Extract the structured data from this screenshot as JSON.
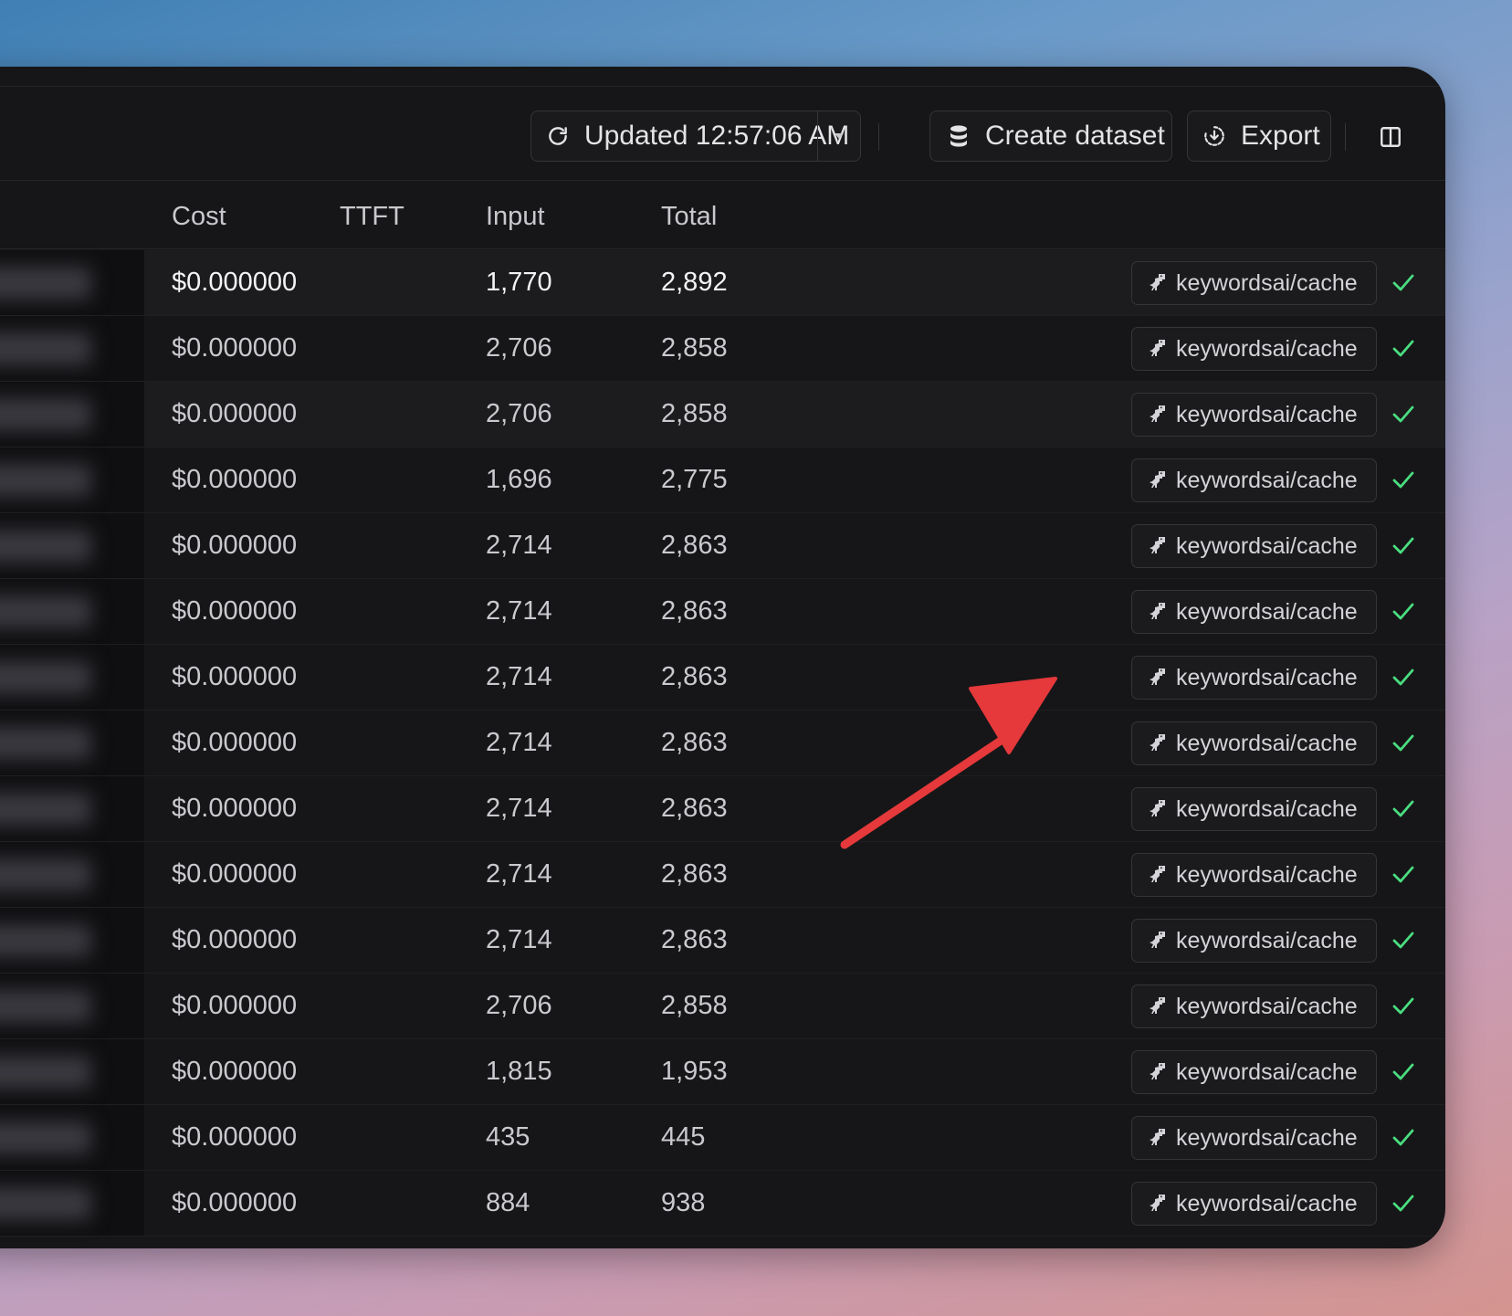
{
  "toolbar": {
    "updated_label": "Updated 12:57:06 AM",
    "create_dataset_label": "Create dataset",
    "export_label": "Export"
  },
  "table": {
    "columns": [
      "Cost",
      "TTFT",
      "Input",
      "Total"
    ],
    "rows": [
      {
        "cost": "$0.000000",
        "ttft": "",
        "input": "1,770",
        "total": "2,892",
        "tag": "keywordsai/cache"
      },
      {
        "cost": "$0.000000",
        "ttft": "",
        "input": "2,706",
        "total": "2,858",
        "tag": "keywordsai/cache"
      },
      {
        "cost": "$0.000000",
        "ttft": "",
        "input": "2,706",
        "total": "2,858",
        "tag": "keywordsai/cache"
      },
      {
        "cost": "$0.000000",
        "ttft": "",
        "input": "1,696",
        "total": "2,775",
        "tag": "keywordsai/cache"
      },
      {
        "cost": "$0.000000",
        "ttft": "",
        "input": "2,714",
        "total": "2,863",
        "tag": "keywordsai/cache"
      },
      {
        "cost": "$0.000000",
        "ttft": "",
        "input": "2,714",
        "total": "2,863",
        "tag": "keywordsai/cache"
      },
      {
        "cost": "$0.000000",
        "ttft": "",
        "input": "2,714",
        "total": "2,863",
        "tag": "keywordsai/cache"
      },
      {
        "cost": "$0.000000",
        "ttft": "",
        "input": "2,714",
        "total": "2,863",
        "tag": "keywordsai/cache"
      },
      {
        "cost": "$0.000000",
        "ttft": "",
        "input": "2,714",
        "total": "2,863",
        "tag": "keywordsai/cache"
      },
      {
        "cost": "$0.000000",
        "ttft": "",
        "input": "2,714",
        "total": "2,863",
        "tag": "keywordsai/cache"
      },
      {
        "cost": "$0.000000",
        "ttft": "",
        "input": "2,714",
        "total": "2,863",
        "tag": "keywordsai/cache"
      },
      {
        "cost": "$0.000000",
        "ttft": "",
        "input": "2,706",
        "total": "2,858",
        "tag": "keywordsai/cache"
      },
      {
        "cost": "$0.000000",
        "ttft": "",
        "input": "1,815",
        "total": "1,953",
        "tag": "keywordsai/cache"
      },
      {
        "cost": "$0.000000",
        "ttft": "",
        "input": "435",
        "total": "445",
        "tag": "keywordsai/cache"
      },
      {
        "cost": "$0.000000",
        "ttft": "",
        "input": "884",
        "total": "938",
        "tag": "keywordsai/cache"
      }
    ]
  },
  "colors": {
    "window_bg": "#161618",
    "success_check": "#4ade80",
    "annotation_arrow": "#e5393b"
  },
  "icons": {
    "refresh": "refresh-icon",
    "caret": "caret-down-icon",
    "database": "database-icon",
    "export": "export-icon",
    "panel": "panel-toggle-icon",
    "tag": "dinosaur-icon",
    "status": "check-icon"
  }
}
